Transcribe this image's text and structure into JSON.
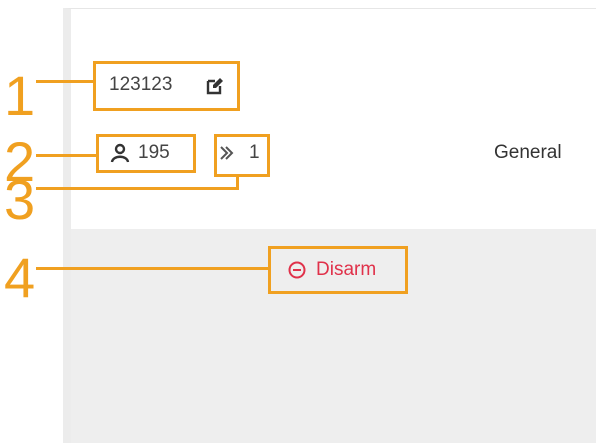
{
  "account": {
    "id_label": "123123",
    "edit_icon": "edit-icon"
  },
  "stats": {
    "users_count": "195",
    "user_icon": "user-icon",
    "devices_count": "1",
    "device_icon": "chevrons-icon"
  },
  "section": {
    "title": "General"
  },
  "actions": {
    "disarm_label": "Disarm",
    "disarm_icon": "minus-circle-icon"
  },
  "callouts": [
    "1",
    "2",
    "3",
    "4"
  ],
  "colors": {
    "callout": "#f0a020",
    "disarm": "#e0314a",
    "text": "#444444",
    "gray_area": "#eeeeee"
  }
}
